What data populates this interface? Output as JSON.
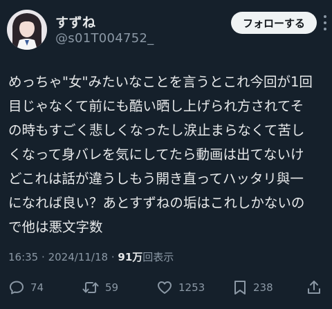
{
  "user": {
    "display_name": "すずね",
    "handle": "@s01T004752_"
  },
  "header": {
    "follow_label": "フォローする"
  },
  "tweet": {
    "lines": [
      "めっちゃ\"女\"みたいなことを言うとこれ今回が1回",
      "目じゃなくて前にも酷い晒し上げられ方されてそ",
      "の時もすごく悲しくなったし涙止まらなくて苦し",
      "くなって身バレを気にしてたら動画は出てないけ",
      "どこれは話が違うしもう開き直ってハッタリ與一",
      "になれば良い？あとすずねの垢はこれしかないの",
      "で他は悪文字数"
    ]
  },
  "meta": {
    "time": "16:35",
    "separator": "·",
    "date": "2024/11/18",
    "views_count": "91万",
    "views_label": "回表示"
  },
  "actions": {
    "reply_count": "74",
    "retweet_count": "59",
    "like_count": "1253",
    "bookmark_count": "238"
  },
  "colors": {
    "background": "#15202b",
    "text": "#e7e9ea",
    "secondary": "#8b98a5",
    "button_bg": "#eff3f4"
  }
}
